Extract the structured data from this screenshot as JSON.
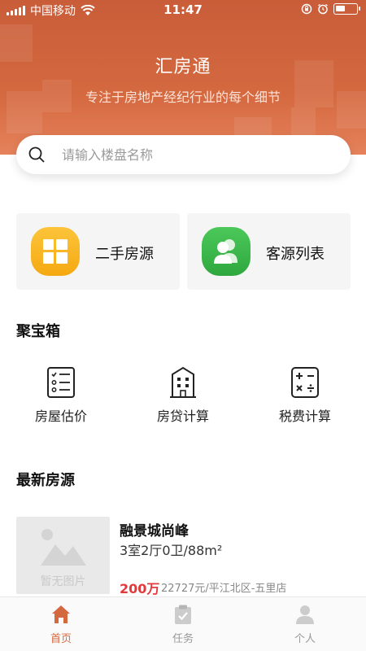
{
  "status_bar": {
    "carrier": "中国移动",
    "time": "11:47",
    "battery_level": 0.45
  },
  "header": {
    "title": "汇房通",
    "subtitle": "专注于房地产经纪行业的每个细节"
  },
  "search": {
    "placeholder": "请输入楼盘名称",
    "value": ""
  },
  "quick_cards": [
    {
      "label": "二手房源",
      "icon": "windows-grid-icon",
      "color": "#f7b81f"
    },
    {
      "label": "客源列表",
      "icon": "people-icon",
      "color": "#39b54a"
    }
  ],
  "treasure": {
    "title": "聚宝箱",
    "tools": [
      {
        "label": "房屋估价",
        "icon": "checklist-icon"
      },
      {
        "label": "房贷计算",
        "icon": "building-icon"
      },
      {
        "label": "税费计算",
        "icon": "calculator-icon"
      }
    ]
  },
  "latest": {
    "title": "最新房源",
    "listings": [
      {
        "no_image_text": "暂无图片",
        "name": "融景城尚峰",
        "spec": "3室2厅0卫/88m²",
        "price": "200万",
        "meta": "22727元/平江北区-五里店"
      }
    ]
  },
  "tabbar": {
    "tabs": [
      {
        "label": "首页",
        "icon": "home-icon",
        "active": true
      },
      {
        "label": "任务",
        "icon": "clipboard-check-icon",
        "active": false
      },
      {
        "label": "个人",
        "icon": "person-icon",
        "active": false
      }
    ]
  },
  "colors": {
    "brand": "#d4683f",
    "price": "#e4393c"
  }
}
